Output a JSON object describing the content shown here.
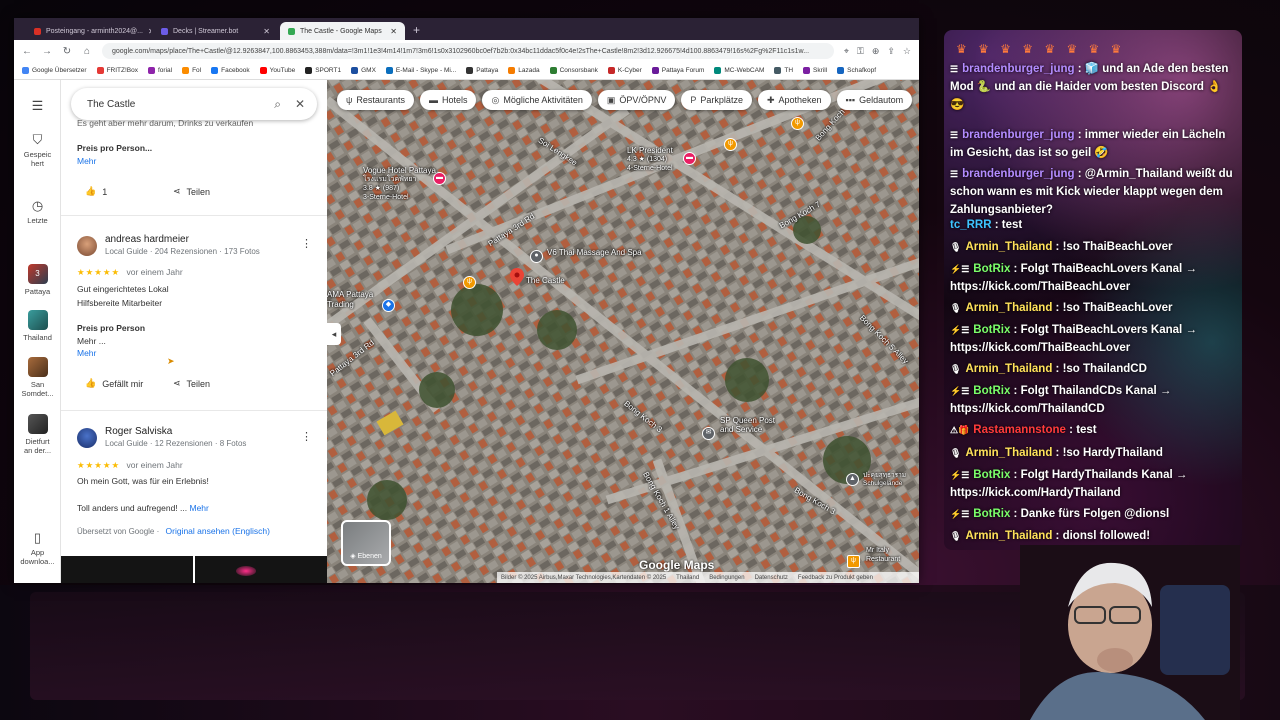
{
  "browser": {
    "tabs": [
      {
        "label": "Posteingang - arminth2024@...",
        "color": "#d93025"
      },
      {
        "label": "Decks | Streamer.bot",
        "color": "#6c5ce7"
      },
      {
        "label": "The Castle - Google Maps",
        "color": "#34a853",
        "active": true
      }
    ],
    "new_tab": "+",
    "url": "google.com/maps/place/The+Castle/@12.9263847,100.8863453,388m/data=!3m1!1e3!4m14!1m7!3m6!1s0x3102960bc0ef7b2b:0x34bc11ddac5f0c4e!2sThe+Castle!8m2!3d12.926675!4d100.8863479!16s%2Fg%2F11c1s1w...",
    "bookmarks": [
      "Google Übersetzer",
      "FRITZ!Box",
      "forial",
      "Fol",
      "Facebook",
      "YouTube",
      "SPORT1",
      "GMX",
      "E-Mail - Skype - Mi...",
      "Pattaya",
      "Lazada",
      "Consorsbank",
      "K-Cyber",
      "Pattaya Forum",
      "MC-WebCAM",
      "TH",
      "Skrill",
      "Schafkopf"
    ]
  },
  "rail": {
    "saved": "Gespeichert",
    "recent": "Letzte",
    "items": [
      "Pattaya",
      "Thailand",
      "San Somdet...",
      "Dietfurt an der..."
    ],
    "app": "App downloa...",
    "pattaya_badge": "3"
  },
  "search": {
    "query": "The Castle"
  },
  "reviews": {
    "prev_snippet": "Es geht aber mehr darum, Drinks zu verkaufen",
    "prev_price_label": "Preis pro Person...",
    "more": "Mehr",
    "prev_likes": "1",
    "share": "Teilen",
    "r1": {
      "name": "andreas hardmeier",
      "meta": "Local Guide · 204 Rezensionen · 173 Fotos",
      "stars": "★★★★★",
      "when": "vor einem Jahr",
      "line1": "Gut eingerichtetes Lokal",
      "line2": "Hilfsbereite Mitarbeiter",
      "price_label": "Preis pro Person",
      "price_more": "Mehr ...",
      "more": "Mehr",
      "like": "Gefällt mir",
      "share": "Teilen"
    },
    "r2": {
      "name": "Roger Salviska",
      "meta": "Local Guide · 12 Rezensionen · 8 Fotos",
      "stars": "★★★★★",
      "when": "vor einem Jahr",
      "line1": "Oh mein Gott, was für ein Erlebnis!",
      "line2": "Toll anders und aufregend! ...",
      "more": "Mehr",
      "translated": "Übersetzt von Google ·",
      "original": "Original ansehen (Englisch)"
    }
  },
  "map": {
    "chips": [
      {
        "icon": "ψ",
        "label": "Restaurants"
      },
      {
        "icon": "▬",
        "label": "Hotels"
      },
      {
        "icon": "◎",
        "label": "Mögliche Aktivitäten"
      },
      {
        "icon": "▣",
        "label": "ÖPV/ÖPNV"
      },
      {
        "icon": "P",
        "label": "Parkplätze"
      },
      {
        "icon": "✚",
        "label": "Apotheken"
      },
      {
        "icon": "▪▪▪",
        "label": "Geldautom"
      }
    ],
    "places": {
      "castle": "The Castle",
      "massage": "V6 Thai Massage And Spa",
      "vogue": "Vogue Hotel Pattaya",
      "vogue_sub": "โรงแรมโวคพัทยา",
      "vogue_rating": "3.8 ★ (987)",
      "vogue_type": "3-Sterne-Hotel",
      "lk": "LK President",
      "lk_rating": "4.3 ★ (1304)",
      "lk_type": "4-Sterne-Hotel",
      "ama": "AMA Pattaya",
      "ama_sub": "Trading",
      "sp": "SP Queen Post and Service",
      "sp_sub": "SP Queen Posts and Service",
      "school": "ปะคุยสุทฺธาราม",
      "school_sub": "Schulgelände",
      "italy": "Mr Italy Restaurant",
      "italy_sub": "Italian Wine"
    },
    "streets": {
      "pattaya3": "Pattaya 3rd Rd",
      "pattaya3b": "Pattaya 3rd Rd",
      "soi_lengkee": "Soi Lengkee",
      "bongkoch3": "Bong Koch 3",
      "bongkoch3b": "Bong Koch 3",
      "bongkoch5": "Bong Koch 5 Alley",
      "bongkoch1": "Bong Koch 1 Alley",
      "bongkoch7": "Bong Koch 7",
      "bongkoch_top": "Bong Koch",
      "soi": "Soi 5"
    },
    "layers": "Ebenen",
    "logo": "Google Maps",
    "attribution": [
      "Bilder © 2025 Airbus,Maxar Technologies,Kartendaten © 2025",
      "Thailand",
      "Bedingungen",
      "Datenschutz",
      "Feedback zu Produkt geben"
    ]
  },
  "chat": {
    "emotes": "♛ ♛ ♛ ♛ ♛ ♛ ♛ ♛",
    "messages": [
      {
        "user": "brandenburger_jung",
        "text": "🧊 und an Ade den besten Mod 🐍 und an die Haider vom besten Discord 👌😎",
        "badge": "☰",
        "color": "brand"
      },
      {
        "user": "brandenburger_jung",
        "text": "immer wieder ein Lächeln im Gesicht, das ist so geil 🤣",
        "badge": "☰",
        "color": "brand"
      },
      {
        "user": "brandenburger_jung",
        "text": "@Armin_Thailand weißt du schon wann es mit Kick wieder klappt wegen dem Zahlungsanbieter?",
        "badge": "☰",
        "color": "brand"
      },
      {
        "user": "tc_RRR",
        "text": "test",
        "badge": "",
        "color": "tc"
      },
      {
        "user": "Armin_Thailand",
        "text": "!so ThaiBeachLover",
        "badge": "🎙",
        "color": "armin"
      },
      {
        "user": "BotRix",
        "text": "Folgt ThaiBeachLovers Kanal → https://kick.com/ThaiBeachLover",
        "badge": "⚡☰",
        "color": "botrix"
      },
      {
        "user": "Armin_Thailand",
        "text": "!so ThaiBeachLover",
        "badge": "🎙",
        "color": "armin"
      },
      {
        "user": "BotRix",
        "text": "Folgt ThaiBeachLovers Kanal → https://kick.com/ThaiBeachLover",
        "badge": "⚡☰",
        "color": "botrix"
      },
      {
        "user": "Armin_Thailand",
        "text": "!so ThailandCD",
        "badge": "🎙",
        "color": "armin"
      },
      {
        "user": "BotRix",
        "text": "Folgt ThailandCDs Kanal → https://kick.com/ThailandCD",
        "badge": "⚡☰",
        "color": "botrix"
      },
      {
        "user": "Rastamannstone",
        "text": "test",
        "badge": "⚠🎁",
        "color": "rasta"
      },
      {
        "user": "Armin_Thailand",
        "text": "!so HardyThailand",
        "badge": "🎙",
        "color": "armin"
      },
      {
        "user": "BotRix",
        "text": "Folgt HardyThailands Kanal → https://kick.com/HardyThailand",
        "badge": "⚡☰",
        "color": "botrix"
      },
      {
        "user": "BotRix",
        "text": "Danke fürs Folgen @dionsl",
        "badge": "⚡☰",
        "color": "botrix"
      },
      {
        "user": "Armin_Thailand",
        "text": "dionsl followed!",
        "badge": "🎙",
        "color": "armin"
      }
    ]
  }
}
